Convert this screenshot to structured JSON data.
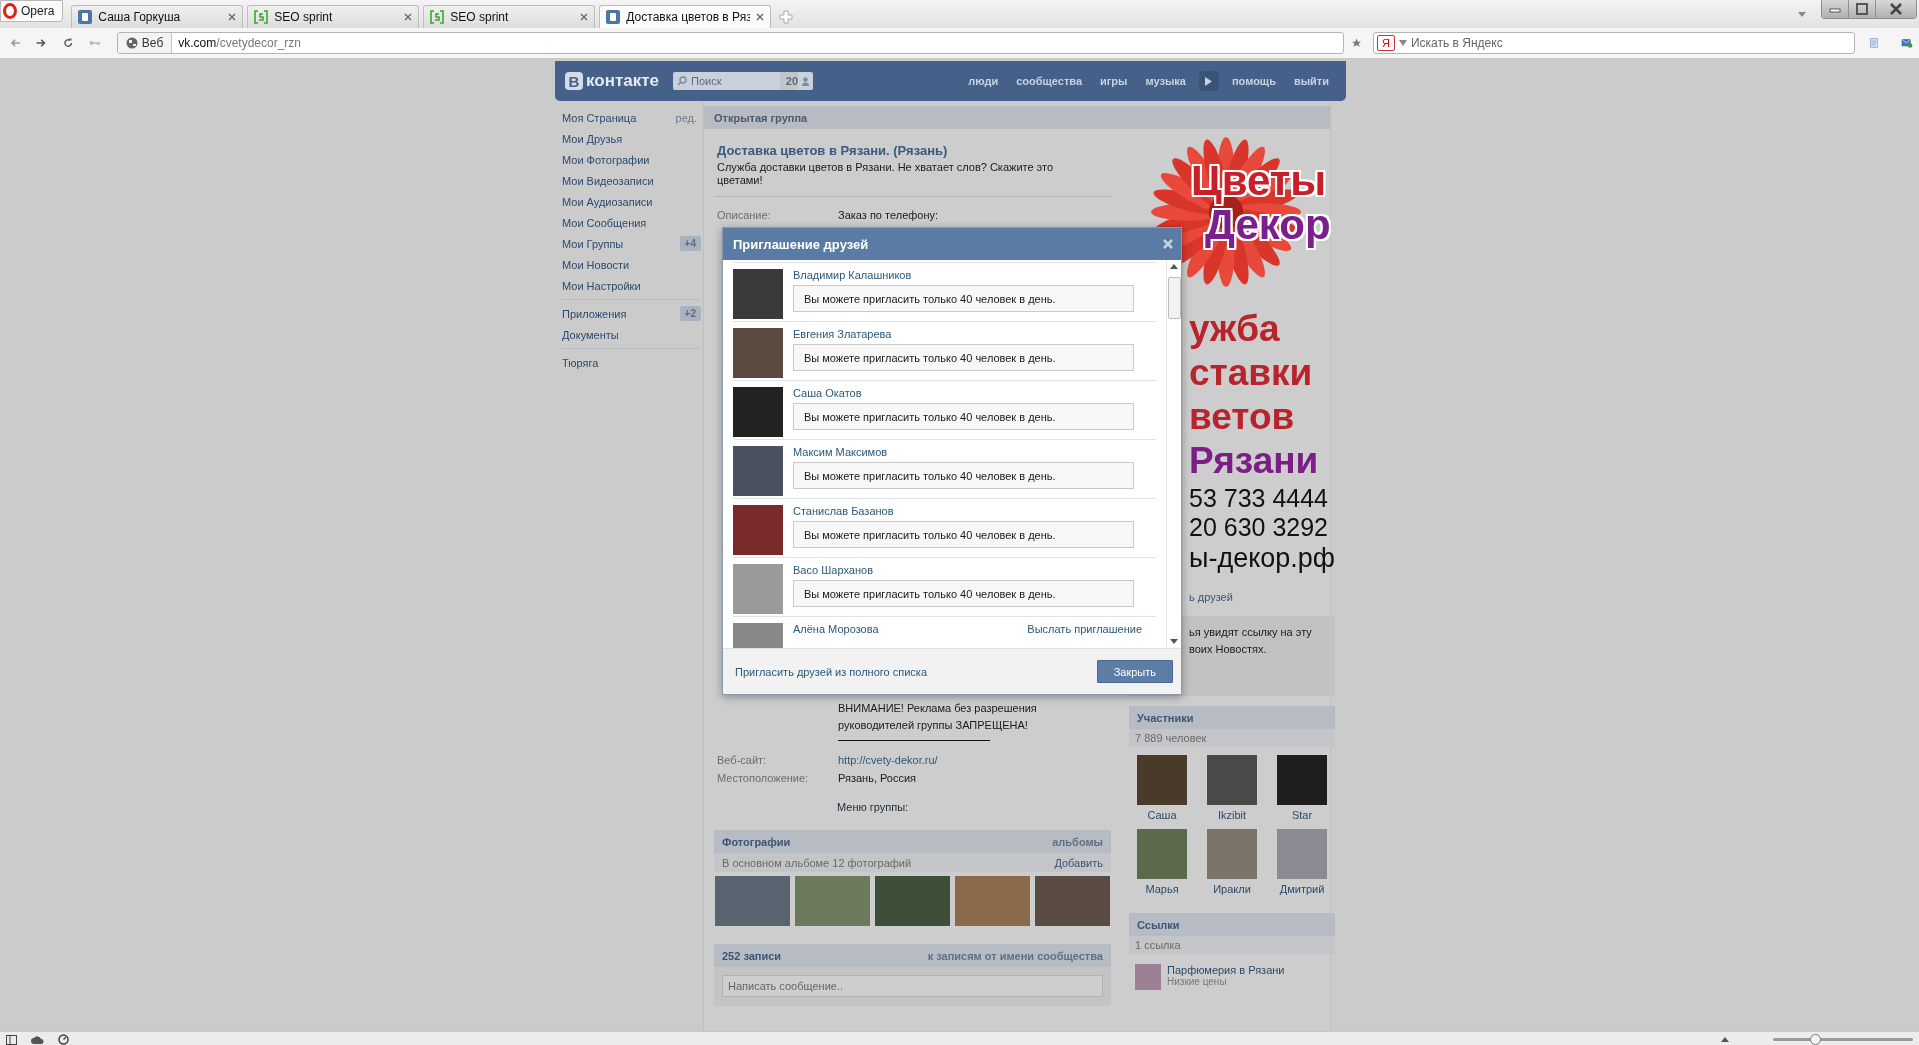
{
  "browser": {
    "opera_label": "Opera",
    "tabs": [
      {
        "title": "Саша Горкуша",
        "kind": "vk",
        "selected": false
      },
      {
        "title": "SEO sprint",
        "kind": "seo",
        "selected": false
      },
      {
        "title": "SEO sprint",
        "kind": "seo",
        "selected": false
      },
      {
        "title": "Доставка цветов в Ряз",
        "kind": "vk",
        "selected": true
      }
    ],
    "address": {
      "badge": "Веб",
      "host": "vk.com",
      "path": "/cvetydecor_rzn"
    },
    "search": {
      "engine_mark": "Я",
      "placeholder": "Искать в Яндекс"
    },
    "zoom": {
      "level": 0.3
    }
  },
  "header": {
    "logo_mark": "В",
    "logo_text": "контакте",
    "search_placeholder": "Поиск",
    "search_count": "20",
    "nav": [
      {
        "kind": "link",
        "label": "люди"
      },
      {
        "kind": "link",
        "label": "сообщества"
      },
      {
        "kind": "link",
        "label": "игры"
      },
      {
        "kind": "link",
        "label": "музыка"
      },
      {
        "kind": "player"
      },
      {
        "kind": "link",
        "label": "помощь"
      },
      {
        "kind": "link",
        "label": "выйти"
      }
    ]
  },
  "sidebar": {
    "sections": [
      {
        "items": [
          {
            "label": "Моя Страница",
            "edit": "ред."
          },
          {
            "label": "Мои Друзья"
          },
          {
            "label": "Мои Фотографии"
          },
          {
            "label": "Мои Видеозаписи"
          },
          {
            "label": "Мои Аудиозаписи"
          },
          {
            "label": "Мои Сообщения"
          },
          {
            "label": "Мои Группы",
            "badge": "+4"
          },
          {
            "label": "Мои Новости"
          },
          {
            "label": "Мои Настройки"
          }
        ]
      },
      {
        "items": [
          {
            "label": "Приложения",
            "badge": "+2"
          },
          {
            "label": "Документы"
          }
        ]
      },
      {
        "items": [
          {
            "label": "Тюряга"
          }
        ]
      }
    ]
  },
  "group": {
    "header": "Открытая группа",
    "title": "Доставка цветов в Рязани. (Рязань)",
    "status": "Служба доставки цветов в Рязани. Не хватает слов? Скажите это цветами!",
    "info": [
      {
        "label": "Описание:",
        "value": "Заказ по телефону:"
      }
    ],
    "notice": "ВНИМАНИЕ! Реклама без разрешения руководителей группы ЗАПРЕЩЕНА!",
    "details": [
      {
        "label": "Веб-сайт:",
        "value": "http://cvety-dekor.ru/",
        "kind": "link"
      },
      {
        "label": "Местоположение:",
        "value": "Рязань, Россия",
        "kind": "text"
      }
    ],
    "menu_label": "Меню группы:"
  },
  "photos": {
    "title": "Фотографии",
    "action": "альбомы",
    "summary": "В основном альбоме 12 фотографий",
    "add": "Добавить",
    "items": [
      {
        "kind": "photo"
      },
      {
        "kind": "photo"
      },
      {
        "kind": "photo"
      },
      {
        "kind": "photo"
      },
      {
        "kind": "photo"
      }
    ]
  },
  "wall": {
    "title": "252 записи",
    "action": "к записям от имени сообщества",
    "placeholder": "Написать сообщение.."
  },
  "aside": {
    "logo": [
      {
        "text": "Цветы",
        "color": "#c8202a"
      },
      {
        "text": "Декор",
        "color": "#7a1f8c"
      }
    ],
    "lines": [
      {
        "text": "ужба",
        "kind": "headline",
        "color": "#b8242b"
      },
      {
        "text": "ставки",
        "kind": "headline",
        "color": "#b8242b"
      },
      {
        "text": "ветов",
        "kind": "headline",
        "color": "#b8242b"
      },
      {
        "text": "Рязани",
        "kind": "headline",
        "color": "#7b1e86"
      },
      {
        "text": "53 733 4444",
        "kind": "phone",
        "color": "#111111"
      },
      {
        "text": "20 630 3292",
        "kind": "phone",
        "color": "#111111"
      },
      {
        "text": "ы-декор.рф",
        "kind": "site",
        "color": "#111111"
      }
    ],
    "invite_fragment": "ь друзей",
    "note_lines": [
      "ья увидят ссылку на эту",
      "воих Новостях."
    ],
    "members": {
      "title": "Участники",
      "count": "7 889 человек",
      "items": [
        {
          "name": "Саша"
        },
        {
          "name": "Ikzibit"
        },
        {
          "name": "Star"
        },
        {
          "name": "Марья"
        },
        {
          "name": "Иракли"
        },
        {
          "name": "Дмитрий"
        }
      ]
    },
    "links": {
      "title": "Ссылки",
      "count": "1 ссылка",
      "items": [
        {
          "title": "Парфюмерия в Рязани",
          "subtitle": "Низкие цены"
        }
      ]
    }
  },
  "dialog": {
    "title": "Приглашение друзей",
    "rows": [
      {
        "name": "Владимир Калашников",
        "kind": "limit",
        "message": "Вы можете пригласить только 40 человек в день."
      },
      {
        "name": "Евгения Златарева",
        "kind": "limit",
        "message": "Вы можете пригласить только 40 человек в день."
      },
      {
        "name": "Саша Окатов",
        "kind": "limit",
        "message": "Вы можете пригласить только 40 человек в день."
      },
      {
        "name": "Максим Максимов",
        "kind": "limit",
        "message": "Вы можете пригласить только 40 человек в день."
      },
      {
        "name": "Станислав Базанов",
        "kind": "limit",
        "message": "Вы можете пригласить только 40 человек в день."
      },
      {
        "name": "Васо Шарханов",
        "kind": "limit",
        "message": "Вы можете пригласить только 40 человек в день."
      },
      {
        "name": "Алёна Морозова",
        "kind": "invite",
        "action": "Выслать приглашение"
      }
    ],
    "footer_link": "Пригласить друзей из полного списка",
    "close": "Закрыть"
  }
}
